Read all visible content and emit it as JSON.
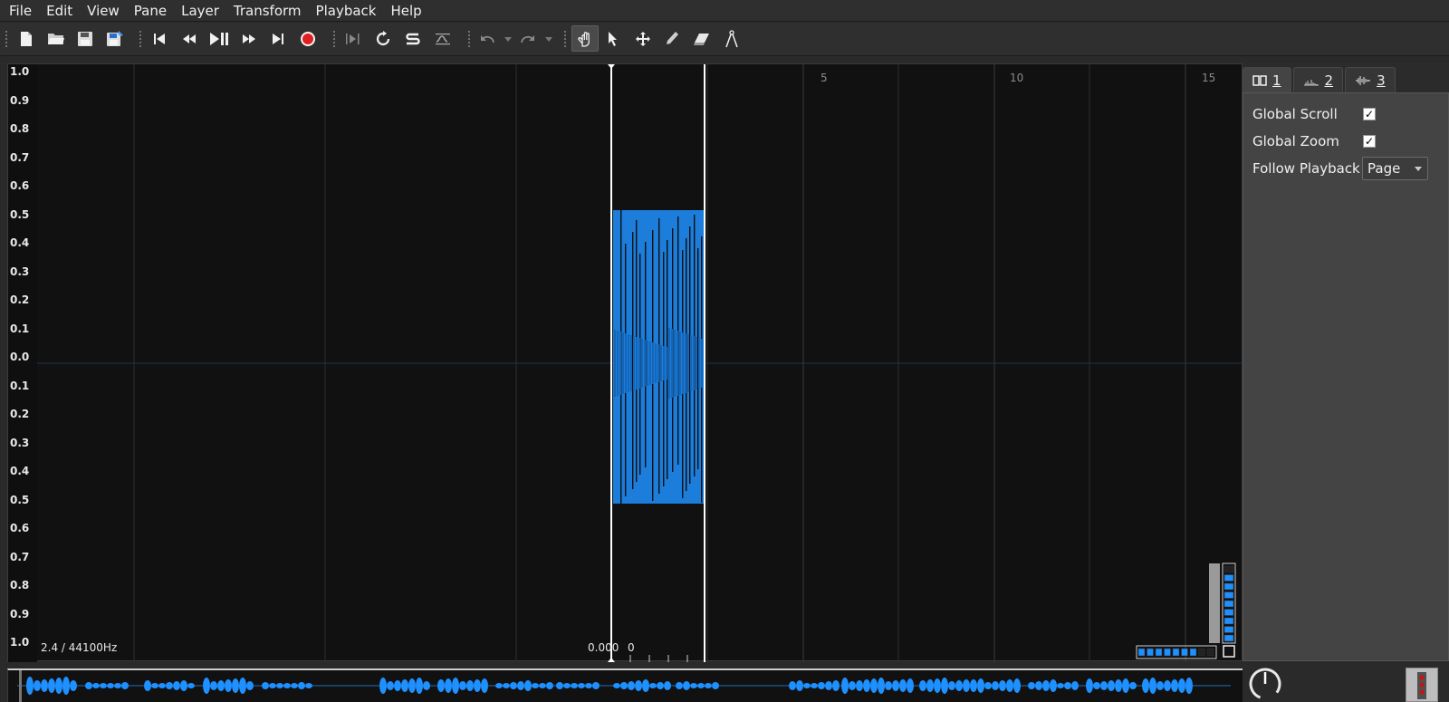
{
  "menu": [
    "File",
    "Edit",
    "View",
    "Pane",
    "Layer",
    "Transform",
    "Playback",
    "Help"
  ],
  "toolbar": {
    "tools": [
      "new-icon",
      "open-icon",
      "save-icon",
      "save-as-icon",
      "rewind-start-icon",
      "rewind-icon",
      "play-pause-icon",
      "fast-forward-icon",
      "forward-end-icon",
      "record-icon",
      "play-selection-icon",
      "loop-icon",
      "solo-icon",
      "normalize-icon",
      "undo-icon",
      "redo-icon",
      "navigate-icon",
      "select-icon",
      "move-icon",
      "draw-icon",
      "erase-icon",
      "measure-icon"
    ],
    "record_color": "#e02020",
    "active_tool": "navigate-icon"
  },
  "pane": {
    "scale_labels": [
      "1.0",
      "0.9",
      "0.8",
      "0.7",
      "0.6",
      "0.5",
      "0.4",
      "0.3",
      "0.2",
      "0.1",
      "0.0",
      "0.1",
      "0.2",
      "0.3",
      "0.4",
      "0.5",
      "0.6",
      "0.7",
      "0.8",
      "0.9",
      "1.0"
    ],
    "ruler_labels": [
      "5",
      "10",
      "15"
    ],
    "rate_label": "2.4 / 44100Hz",
    "position_label": "0.000",
    "position_zero": "0",
    "waveform_color": "#1e90ff"
  },
  "panel": {
    "tabs": [
      {
        "label": "1",
        "icon": "pane-icon"
      },
      {
        "label": "2",
        "icon": "spectrum-icon"
      },
      {
        "label": "3",
        "icon": "waveform-icon"
      }
    ],
    "global_scroll_label": "Global Scroll",
    "global_scroll_checked": "✓",
    "global_zoom_label": "Global Zoom",
    "global_zoom_checked": "✓",
    "follow_playback_label": "Follow Playback",
    "follow_playback_value": "Page"
  }
}
